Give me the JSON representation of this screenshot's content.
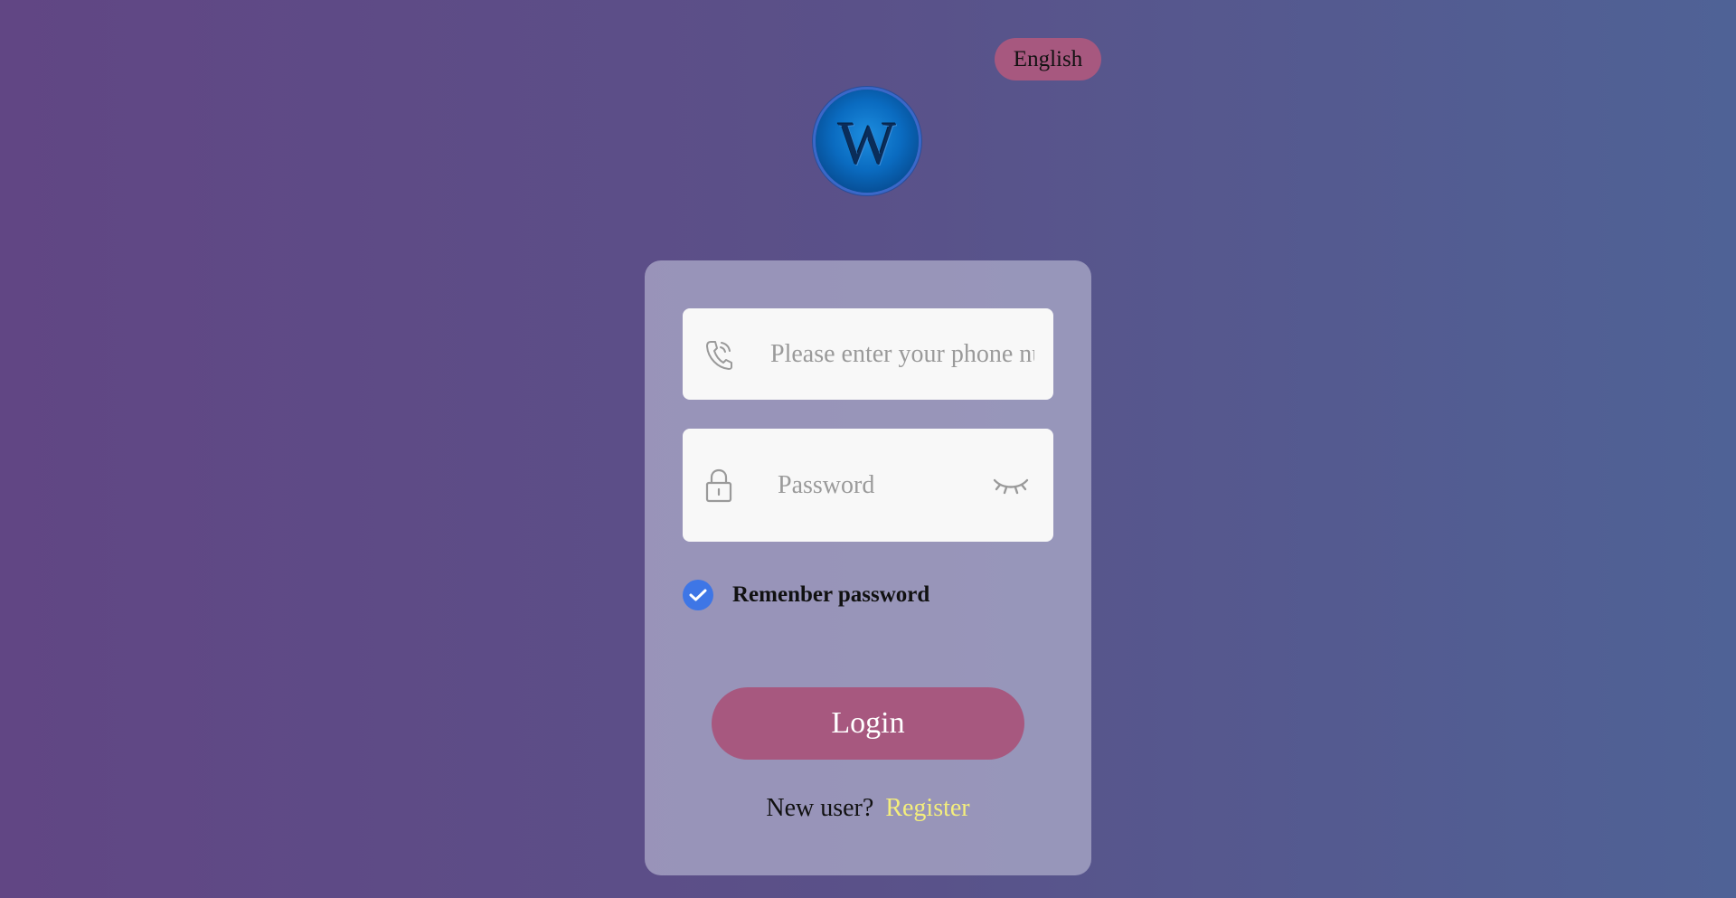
{
  "language": {
    "label": "English"
  },
  "logo": {
    "letter": "W"
  },
  "form": {
    "phone": {
      "placeholder": "Please enter your phone number",
      "value": ""
    },
    "password": {
      "placeholder": "Password",
      "value": ""
    },
    "remember": {
      "label": "Remenber password",
      "checked": true
    },
    "login_label": "Login",
    "new_user_text": "New user?",
    "register_label": "Register"
  },
  "colors": {
    "accent": "#a7587f",
    "checkbox": "#3e76e6",
    "register_link": "#f4ee7c"
  },
  "icons": {
    "phone": "phone-icon",
    "lock": "lock-icon",
    "eye": "eye-closed-icon",
    "check": "check-icon"
  }
}
